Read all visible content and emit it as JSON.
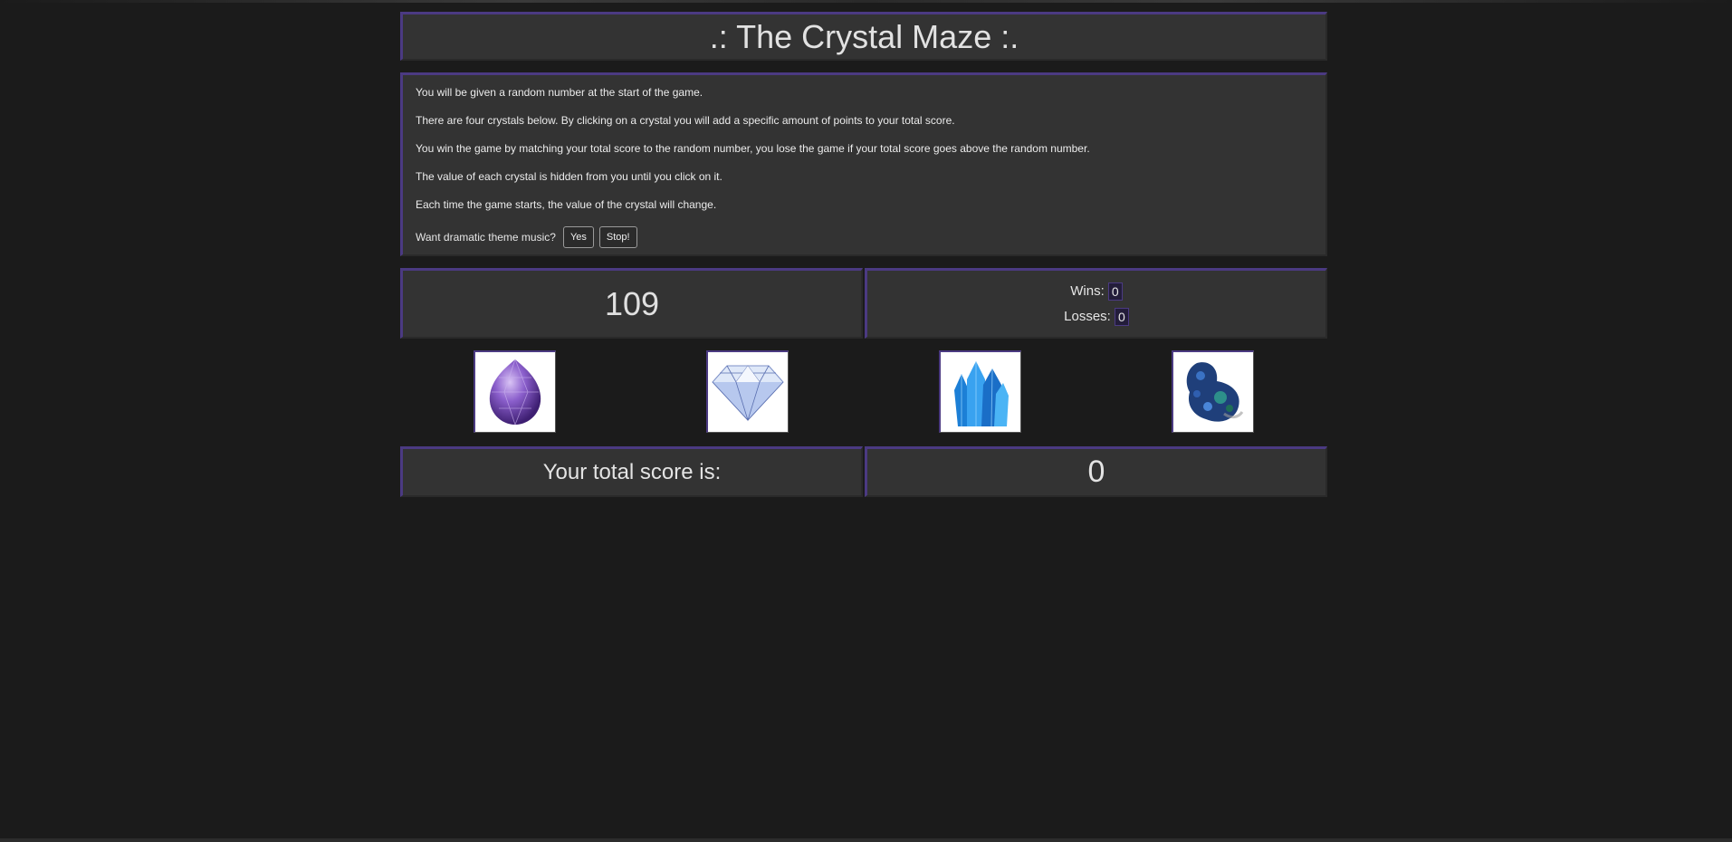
{
  "header": {
    "title": ".: The Crystal Maze :."
  },
  "rules": {
    "lines": [
      "You will be given a random number at the start of the game.",
      "There are four crystals below. By clicking on a crystal you will add a specific amount of points to your total score.",
      "You win the game by matching your total score to the random number, you lose the game if your total score goes above the random number.",
      "The value of each crystal is hidden from you until you click on it.",
      "Each time the game starts, the value of the crystal will change."
    ],
    "music_question": "Want dramatic theme music?",
    "music_yes_label": "Yes",
    "music_stop_label": "Stop!"
  },
  "game": {
    "target_number": "109",
    "wins_label": "Wins:",
    "wins_value": "0",
    "losses_label": "Losses:",
    "losses_value": "0",
    "score_label": "Your total score is:",
    "score_value": "0"
  },
  "crystals": [
    {
      "name": "amethyst",
      "icon": "purple-sphere-crystal-icon",
      "color": "#8a5cc9"
    },
    {
      "name": "diamond",
      "icon": "diamond-icon",
      "color": "#9fb6e6"
    },
    {
      "name": "blue-cluster",
      "icon": "blue-crystal-cluster-icon",
      "color": "#2a8ae0"
    },
    {
      "name": "azurite",
      "icon": "azurite-rock-icon",
      "color": "#2b4f8a"
    }
  ],
  "theme": {
    "accent": "#4b3a82",
    "panel": "#333333",
    "background": "#1b1b1b"
  }
}
